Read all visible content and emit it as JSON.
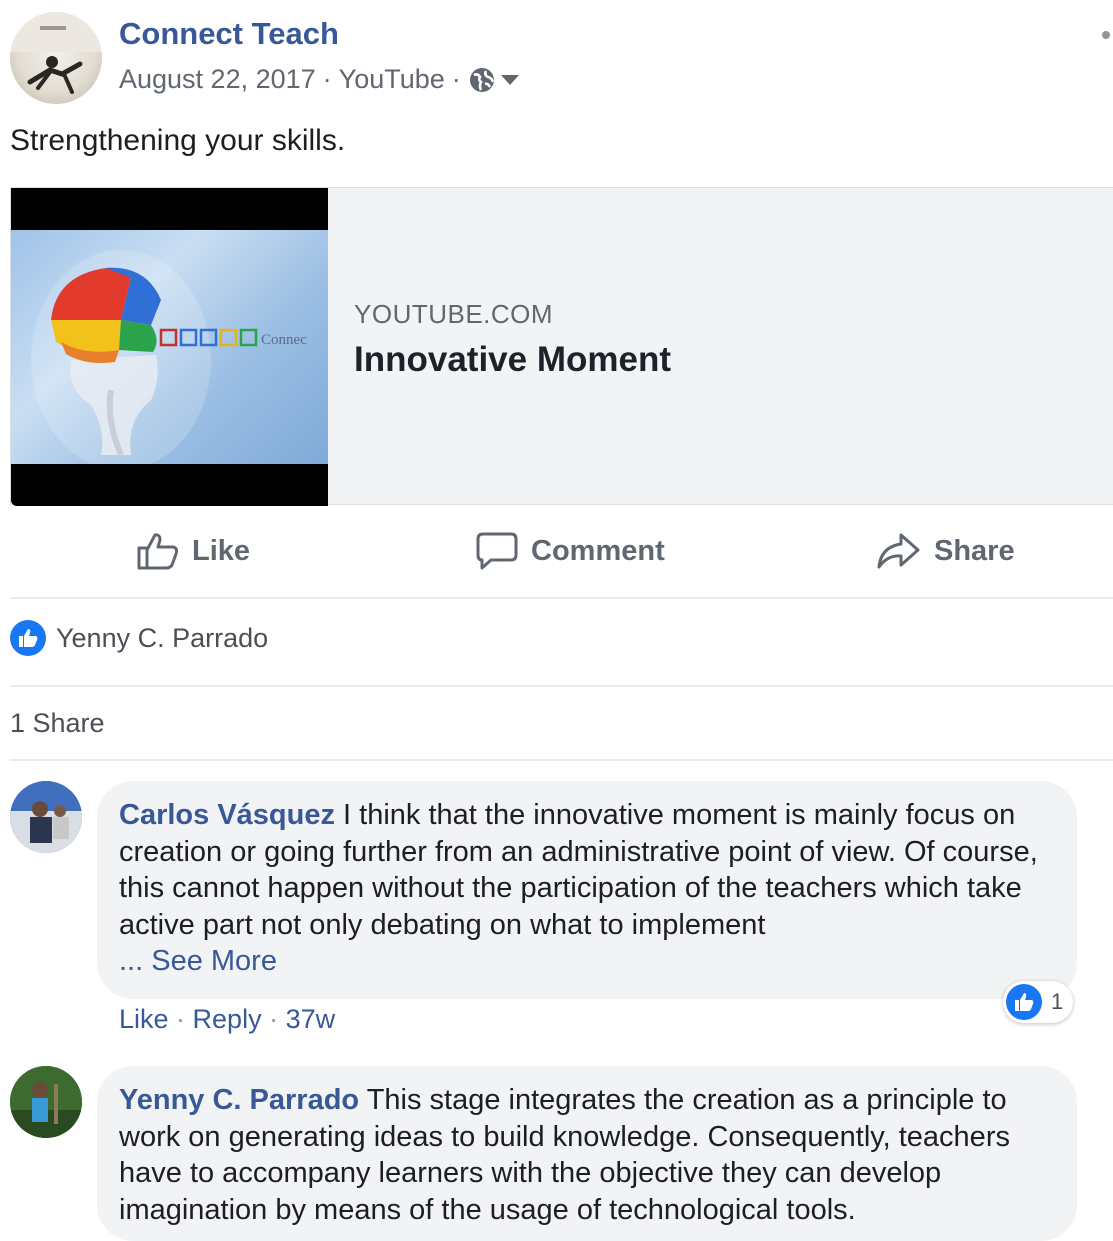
{
  "post": {
    "author": "Connect Teach",
    "date": "August 22, 2017",
    "source": "YouTube",
    "caption": "Strengthening your skills."
  },
  "link": {
    "domain": "YOUTUBE.COM",
    "title": "Innovative Moment",
    "thumb_text": "Connec"
  },
  "actions": {
    "like": "Like",
    "comment": "Comment",
    "share": "Share"
  },
  "reactions": {
    "names": "Yenny C. Parrado"
  },
  "shares": "1 Share",
  "comments": [
    {
      "author": "Carlos Vásquez",
      "text": " I think that the innovative moment is mainly focus on creation or going further from an administrative point of view. Of course, this cannot happen without the participation of the teachers which take active part not only debating on what to implement",
      "see_more": "... See More",
      "like": "Like",
      "reply": "Reply",
      "time": "37w",
      "reaction_count": "1"
    },
    {
      "author": "Yenny C. Parrado",
      "text": " This stage integrates the creation as a principle to work on generating ideas to build knowledge. Consequently, teachers have to accompany learners with the objective they can develop imagination by means of the usage of technological tools."
    }
  ],
  "colors": {
    "link_blue": "#385898",
    "like_blue": "#1877f2",
    "muted": "#606770"
  },
  "icons": [
    "globe-icon",
    "caret-down-icon",
    "more-icon",
    "like-icon",
    "comment-icon",
    "share-icon",
    "like-reaction-icon"
  ]
}
